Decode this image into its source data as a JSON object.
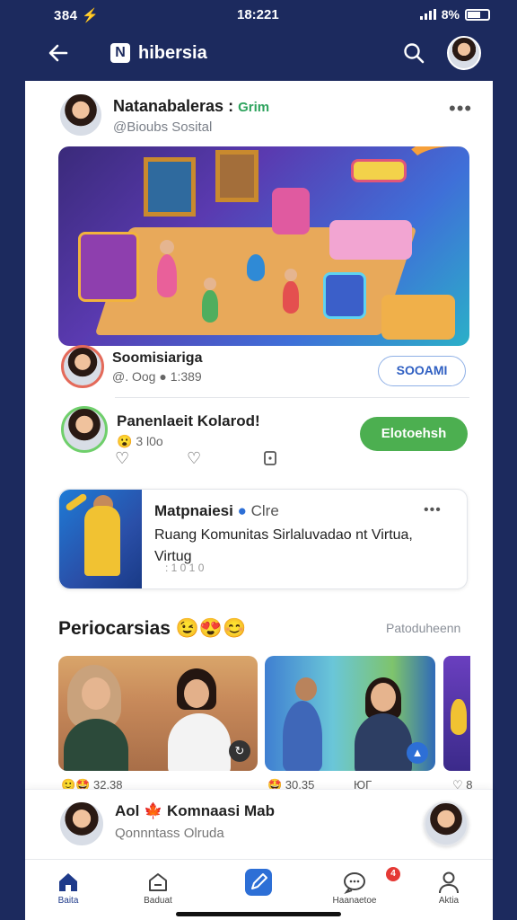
{
  "status": {
    "time": "384 ⚡",
    "center": "18:221",
    "battery": "8%"
  },
  "appbar": {
    "brand": "hibersia",
    "logo_letter": "N"
  },
  "post": {
    "author": "Natanabaleras :",
    "author_tag": "Grim",
    "handle": "@Bioubs Sosital",
    "more": "•••"
  },
  "comment1": {
    "name": "Soomisiarigа",
    "meta": "@. Oog ● 1:389",
    "action": "SOOAMI"
  },
  "comment2": {
    "name": "Panenlaeit Kolarod!",
    "meta": "3 l0o",
    "action": "Elotoehsh"
  },
  "featured": {
    "title": "Matpnaiesi",
    "title_tag": "Clre",
    "line1": "Ruang Komunitas Sirlaluvadao nt Virtua,",
    "line2": "Virtug",
    "line3": ": 1 0 1 0",
    "more": "•••"
  },
  "section": {
    "title": "Periocarsias 😉😍😊",
    "link": "Patoduheenn"
  },
  "photo_stats": {
    "left": "🙂🤩 32.38",
    "mid": "🤩 30.35",
    "mid2": "ЮГ",
    "right": "♡ 8"
  },
  "bottom_card": {
    "title": "Aol 🍁 Komnaasi Mab",
    "subtitle": "Qonnntass Olruda"
  },
  "tabs": [
    {
      "label": "Baita"
    },
    {
      "label": "Baduat"
    },
    {
      "label": ""
    },
    {
      "label": "Haanaetoe"
    },
    {
      "label": "Aktia"
    }
  ],
  "notification_count": "4",
  "colors": {
    "primary": "#1c2a5e",
    "green": "#4caf50",
    "accent_blue": "#2d6fd6"
  }
}
